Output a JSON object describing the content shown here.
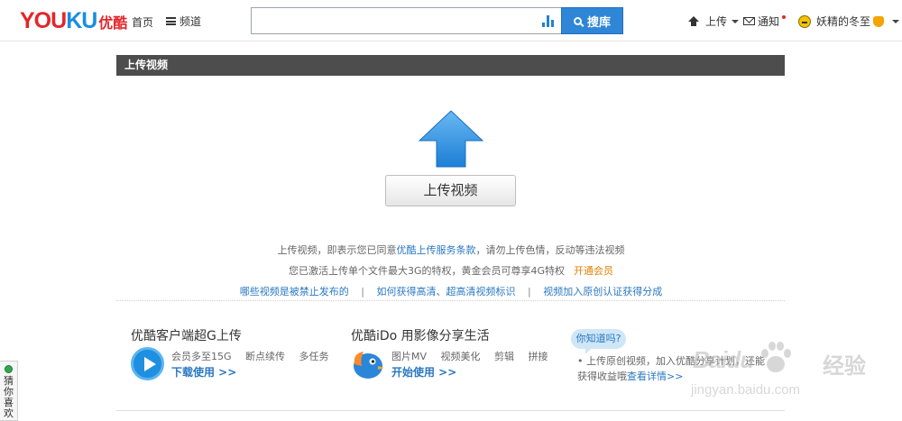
{
  "header": {
    "logo_en_part1": "YOU",
    "logo_en_part2": "KU",
    "logo_cn": "优酷",
    "nav_home": "首页",
    "nav_channel": "频道",
    "search_placeholder": "",
    "search_button": "搜库",
    "upload_label": "上传",
    "notify_label": "通知",
    "username": "妖精的冬至"
  },
  "section": {
    "title": "上传视频"
  },
  "upload": {
    "button_label": "上传视频"
  },
  "notices": {
    "line1_prefix": "上传视频，即表示您已同意",
    "line1_link": "优酷上传服务条款",
    "line1_suffix": "，请勿上传色情，反动等违法视频",
    "line2_text": "您已激活上传单个文件最大3G的特权，黄金会员可尊享4G特权",
    "line2_link": "开通会员",
    "links": [
      "哪些视频是被禁止发布的",
      "如何获得高清、超高清视频标识",
      "视频加入原创认证获得分成"
    ],
    "separator": "|"
  },
  "promos": {
    "client": {
      "title": "优酷客户端超G上传",
      "features": [
        "会员多至15G",
        "断点续传",
        "多任务"
      ],
      "link": "下载使用 >>"
    },
    "ido": {
      "title": "优酷iDo 用影像分享生活",
      "features": [
        "图片MV",
        "视频美化",
        "剪辑",
        "拼接"
      ],
      "link": "开始使用 >>"
    },
    "tip": {
      "bubble": "你知道吗?",
      "text": "• 上传原创视频，加入优酷分享计划，还能获得收益哦",
      "link": "查看详情>>"
    }
  },
  "side_tab": {
    "label": "猜你喜欢"
  },
  "watermark": {
    "brand": "Baidu",
    "cn": "经验",
    "url": "jingyan.baidu.com"
  },
  "colors": {
    "brand_red": "#e4262b",
    "brand_blue": "#1a8ee1",
    "search_blue": "#2f86d6",
    "section_bar": "#4d4d4d",
    "link_blue": "#2a78c2",
    "vip_orange": "#e67e00"
  },
  "icons": {
    "upload_arrow": "up-arrow-icon",
    "search": "search-icon",
    "chart": "bar-chart-icon",
    "mail": "mail-icon",
    "client": "play-icon",
    "ido": "bird-icon"
  }
}
